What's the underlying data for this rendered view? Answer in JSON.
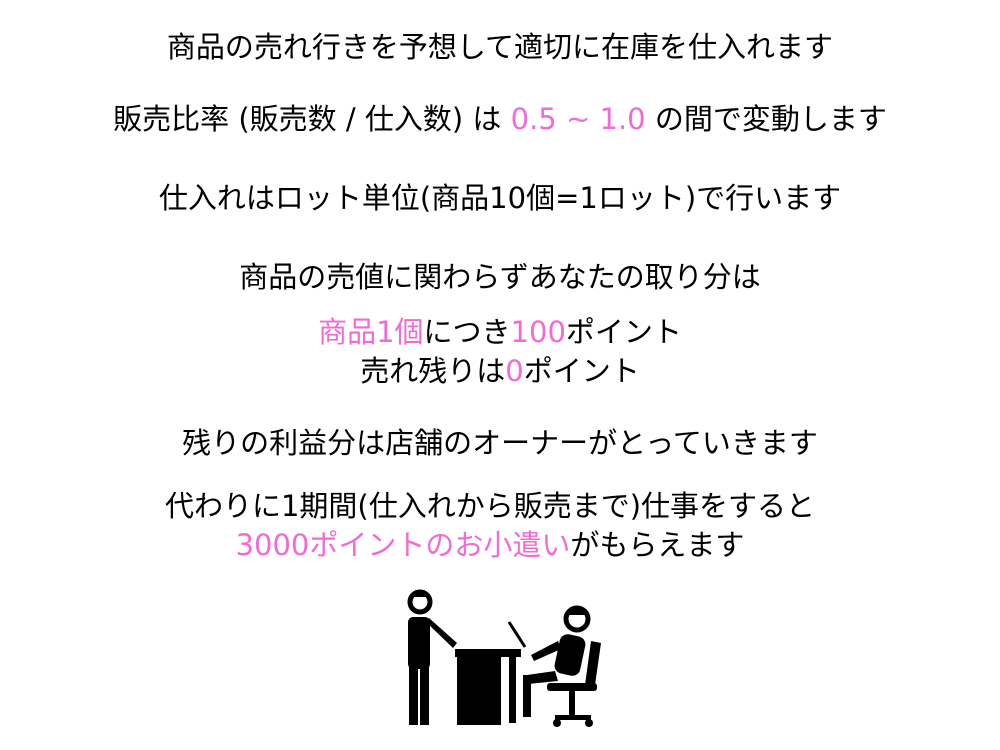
{
  "colors": {
    "text": "#000000",
    "highlight": "#f26ad5",
    "background": "#ffffff"
  },
  "lines": {
    "l1": "商品の売れ行きを予想して適切に在庫を仕入れます",
    "l2_a": "販売比率 (販売数 / 仕入数) は ",
    "l2_b": "0.5 ~ 1.0",
    "l2_c": " の間で変動します",
    "l3": "仕入れはロット単位(商品10個=1ロット)で行います",
    "l4": "商品の売値に関わらずあなたの取り分は",
    "l5_a": "商品1個",
    "l5_b": "につき",
    "l5_c": "100",
    "l5_d": "ポイント",
    "l6_a": "売れ残りは",
    "l6_b": "0",
    "l6_c": "ポイント",
    "l7": "残りの利益分は店舗のオーナーがとっていきます",
    "l8": "代わりに1期間(仕入れから販売まで)仕事をすると",
    "l9_a": "3000ポイントのお小遣い",
    "l9_b": "がもらえます"
  },
  "illustration": {
    "icon": "office-meeting-icon"
  }
}
